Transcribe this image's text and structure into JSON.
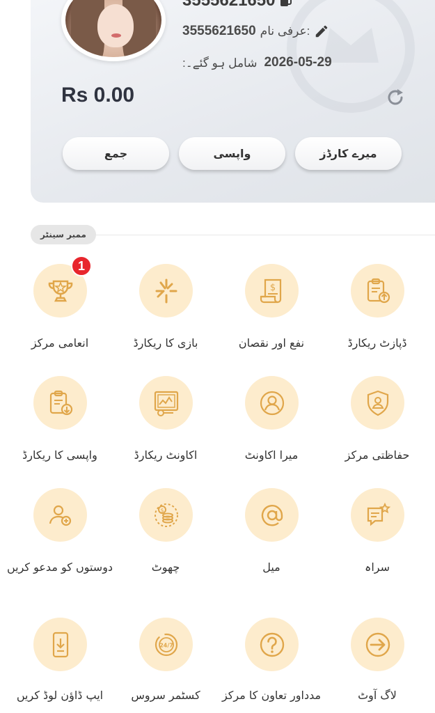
{
  "profile": {
    "user_id": "3555621650",
    "nickname_label": "عرفی نام:",
    "nickname_value": "3555621650",
    "joined_date": "2026-05-29",
    "joined_label": ":شامل ہو گئے۔",
    "balance": "Rs 0.00"
  },
  "actions": {
    "deposit": "جمع",
    "withdraw": "واپسی",
    "my_cards": "میرے کارڈز"
  },
  "section": {
    "title": "ممبر سینٹر"
  },
  "menu": {
    "reward_center": "انعامی مرکز",
    "reward_badge": "1",
    "bet_record": "بازی کا ریکارڈ",
    "profit_loss": "نفع اور نقصان",
    "deposit_record": "ڈپازٹ ریکارڈ",
    "withdraw_record": "واپسی کا ریکارڈ",
    "account_record": "اکاونٹ ریکارڈ",
    "my_account": "میرا اکاونٹ",
    "security_center": "حفاظتی مرکز",
    "invite_friends": "دوستوں کو مدعو کریں",
    "rebate": "چھوٹ",
    "mail": "میل",
    "feedback": "سراہ",
    "app_download": "ایپ ڈاؤن لوڈ کریں",
    "customer_service": "کسٹمر سروس",
    "help_center": "مدداور تعاون کا مرکز",
    "logout": "لاگ آوٹ"
  },
  "colors": {
    "icon_bg": "#fdeccd",
    "icon_fg": "#e0a64a",
    "badge": "#e8262d"
  }
}
